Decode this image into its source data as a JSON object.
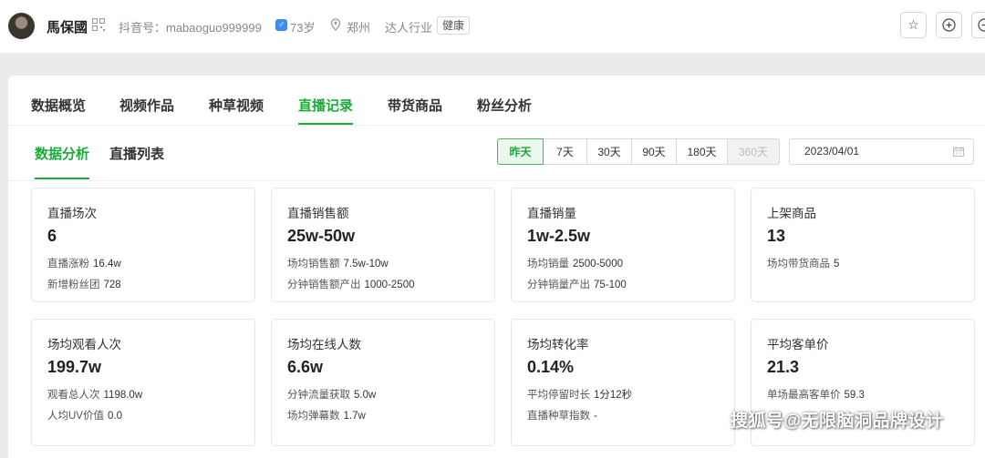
{
  "profile": {
    "name": "馬保國",
    "douyin_id": "抖音号：mabaoguo999999",
    "gender_icon": "male-icon",
    "age": "73岁",
    "city": "郑州",
    "industry": "达人行业",
    "tag": "健康"
  },
  "header_actions": {
    "star_icon": "star-icon",
    "add_icon": "plus-circle-icon",
    "minus_icon": "minus-circle-icon"
  },
  "main_tabs": [
    {
      "label": "数据概览"
    },
    {
      "label": "视频作品"
    },
    {
      "label": "种草视频"
    },
    {
      "label": "直播记录"
    },
    {
      "label": "带货商品"
    },
    {
      "label": "粉丝分析"
    }
  ],
  "active_main_tab": "直播记录",
  "sub_tabs": [
    {
      "label": "数据分析"
    },
    {
      "label": "直播列表"
    }
  ],
  "range_options": [
    "昨天",
    "7天",
    "30天",
    "90天",
    "180天",
    "360天"
  ],
  "selected_range": "昨天",
  "date_value": "2023/04/01",
  "stats": [
    {
      "title": "直播场次",
      "value": "6",
      "rows": [
        {
          "label": "直播涨粉",
          "value": "16.4w"
        },
        {
          "label": "新增粉丝团",
          "value": "728"
        }
      ]
    },
    {
      "title": "直播销售额",
      "value": "25w-50w",
      "rows": [
        {
          "label": "场均销售额",
          "value": "7.5w-10w"
        },
        {
          "label": "分钟销售额产出",
          "value": "1000-2500"
        }
      ]
    },
    {
      "title": "直播销量",
      "value": "1w-2.5w",
      "rows": [
        {
          "label": "场均销量",
          "value": "2500-5000"
        },
        {
          "label": "分钟销量产出",
          "value": "75-100"
        }
      ]
    },
    {
      "title": "上架商品",
      "value": "13",
      "rows": [
        {
          "label": "场均带货商品",
          "value": "5"
        }
      ]
    },
    {
      "title": "场均观看人次",
      "value": "199.7w",
      "rows": [
        {
          "label": "观看总人次",
          "value": "1198.0w"
        },
        {
          "label": "人均UV价值",
          "value": "0.0"
        }
      ]
    },
    {
      "title": "场均在线人数",
      "value": "6.6w",
      "rows": [
        {
          "label": "分钟流量获取",
          "value": "5.0w"
        },
        {
          "label": "场均弹幕数",
          "value": "1.7w"
        }
      ]
    },
    {
      "title": "场均转化率",
      "value": "0.14%",
      "rows": [
        {
          "label": "平均停留时长",
          "value": "1分12秒"
        },
        {
          "label": "直播种草指数",
          "value": "-"
        }
      ]
    },
    {
      "title": "平均客单价",
      "value": "21.3",
      "rows": [
        {
          "label": "单场最高客单价",
          "value": "59.3"
        }
      ]
    }
  ],
  "watermark": "搜狐号@无限脑洞品牌设计",
  "colors": {
    "accent": "#1aab3a",
    "male_badge": "#3d8bf5"
  }
}
